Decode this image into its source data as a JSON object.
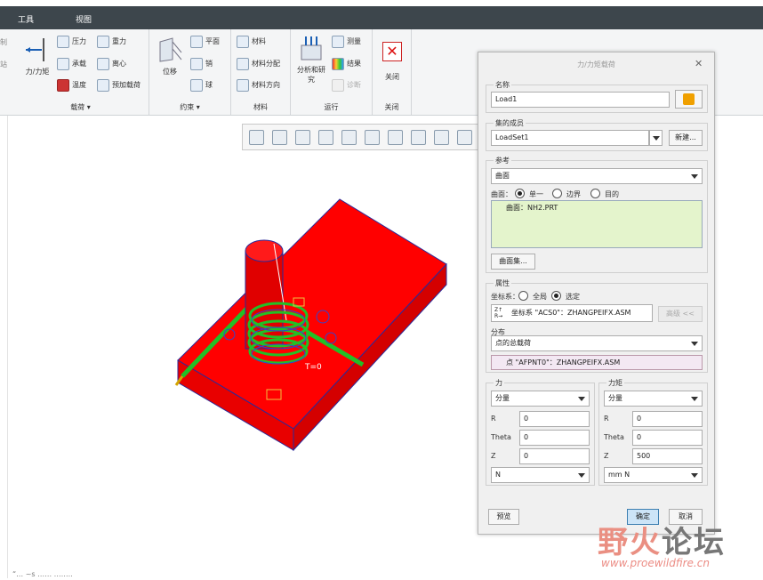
{
  "menubar": {
    "tab_tools": "工具",
    "tab_view": "视图"
  },
  "ribbon": {
    "partial_left": [
      "制",
      "站"
    ],
    "loads_group": {
      "big_button": "力/力矩",
      "items": [
        "压力",
        "重力",
        "承载",
        "离心",
        "温度",
        "预加载荷"
      ],
      "label": "载荷"
    },
    "constraints_group": {
      "big_button": "位移",
      "items": [
        "平面",
        "销",
        "球"
      ],
      "label": "约束"
    },
    "materials_group": {
      "items": [
        "材料",
        "材料分配",
        "材料方向"
      ],
      "label": "材料"
    },
    "run_group": {
      "big_button": "分析和研究",
      "items": [
        "测量",
        "结果",
        "诊断"
      ],
      "label": "运行"
    },
    "close_group": {
      "big_button": "关闭",
      "label": "关闭"
    }
  },
  "viewport": {
    "annotation_t": "T=0",
    "status_text": "“…  ~s  ……  …….."
  },
  "dialog": {
    "title": "力/力矩载荷",
    "name_legend": "名称",
    "name_value": "Load1",
    "member_legend": "集的成员",
    "member_value": "LoadSet1",
    "new_button": "新建...",
    "reference_legend": "参考",
    "reference_type": "曲面",
    "surface_label": "曲面：",
    "radio_single": "单一",
    "radio_boundary": "边界",
    "radio_intent": "目的",
    "surface_item": "曲面：NH2.PRT",
    "surface_set_button": "曲面集...",
    "properties_legend": "属性",
    "coord_label": "坐标系：",
    "radio_global": "全局",
    "radio_selected": "选定",
    "coord_value": "坐标系 \"ACS0\"：ZHANGPEIFX.ASM",
    "advanced_button": "高级 <<",
    "distribution_label": "分布",
    "distribution_value": "点的总载荷",
    "point_value": "点 \"AFPNT0\"：ZHANGPEIFX.ASM",
    "force_legend": "力",
    "moment_legend": "力矩",
    "force_mode": "分量",
    "moment_mode": "分量",
    "force_rows": [
      {
        "label": "R",
        "value": "0"
      },
      {
        "label": "Theta",
        "value": "0"
      },
      {
        "label": "Z",
        "value": "0"
      }
    ],
    "moment_rows": [
      {
        "label": "R",
        "value": "0"
      },
      {
        "label": "Theta",
        "value": "0"
      },
      {
        "label": "Z",
        "value": "500"
      }
    ],
    "force_unit": "N",
    "moment_unit": "mm N",
    "preview_button": "预览",
    "ok_button": "确定",
    "cancel_button": "取消"
  },
  "watermark": {
    "cn_part1": "野火",
    "cn_part2": "论坛",
    "url": "www.proewildfire.cn"
  },
  "colors": {
    "menubar": "#3d464c",
    "model_red": "#ff0000",
    "spring_green": "#22c026",
    "dialog_bg": "#f0f0f0",
    "field_green": "#e4f4cc"
  }
}
